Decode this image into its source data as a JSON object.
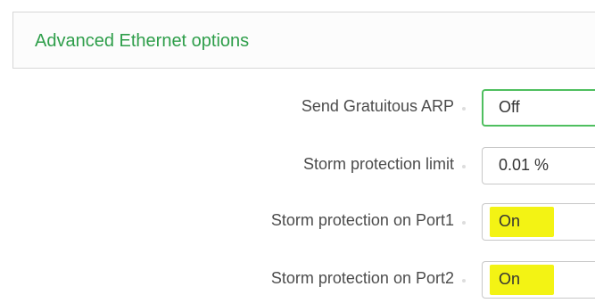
{
  "section": {
    "title": "Advanced Ethernet options"
  },
  "rows": [
    {
      "label": "Send Gratuitous ARP",
      "value": "Off"
    },
    {
      "label": "Storm protection limit",
      "value": "0.01 %"
    },
    {
      "label": "Storm protection on Port1",
      "value": "On"
    },
    {
      "label": "Storm protection on Port2",
      "value": "On"
    }
  ],
  "colors": {
    "accent": "#2e9e4a",
    "focus_border": "#4fbf5f",
    "highlight": "#f2f200",
    "label_text": "#4c4c4c"
  }
}
